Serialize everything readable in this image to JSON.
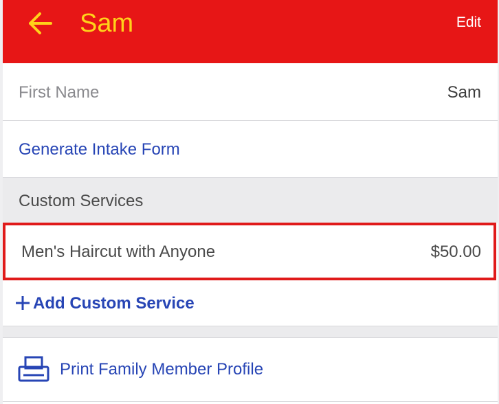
{
  "header": {
    "title": "Sam",
    "back_icon": "arrow-left-icon",
    "edit_label": "Edit",
    "background_color": "#e71616",
    "title_color": "#ffd21a"
  },
  "fields": {
    "first_name_label": "First Name",
    "first_name_value": "Sam"
  },
  "actions": {
    "generate_intake_form": "Generate Intake Form",
    "add_custom_service": "Add Custom Service",
    "add_icon": "plus-icon",
    "print_profile": "Print Family Member Profile",
    "print_icon": "printer-icon"
  },
  "custom_services": {
    "section_title": "Custom Services",
    "items": [
      {
        "name": "Men's Haircut with Anyone",
        "price": "$50.00"
      }
    ]
  },
  "colors": {
    "link": "#2745b5",
    "highlight_border": "#e01a1a",
    "section_background": "#ebebed"
  }
}
